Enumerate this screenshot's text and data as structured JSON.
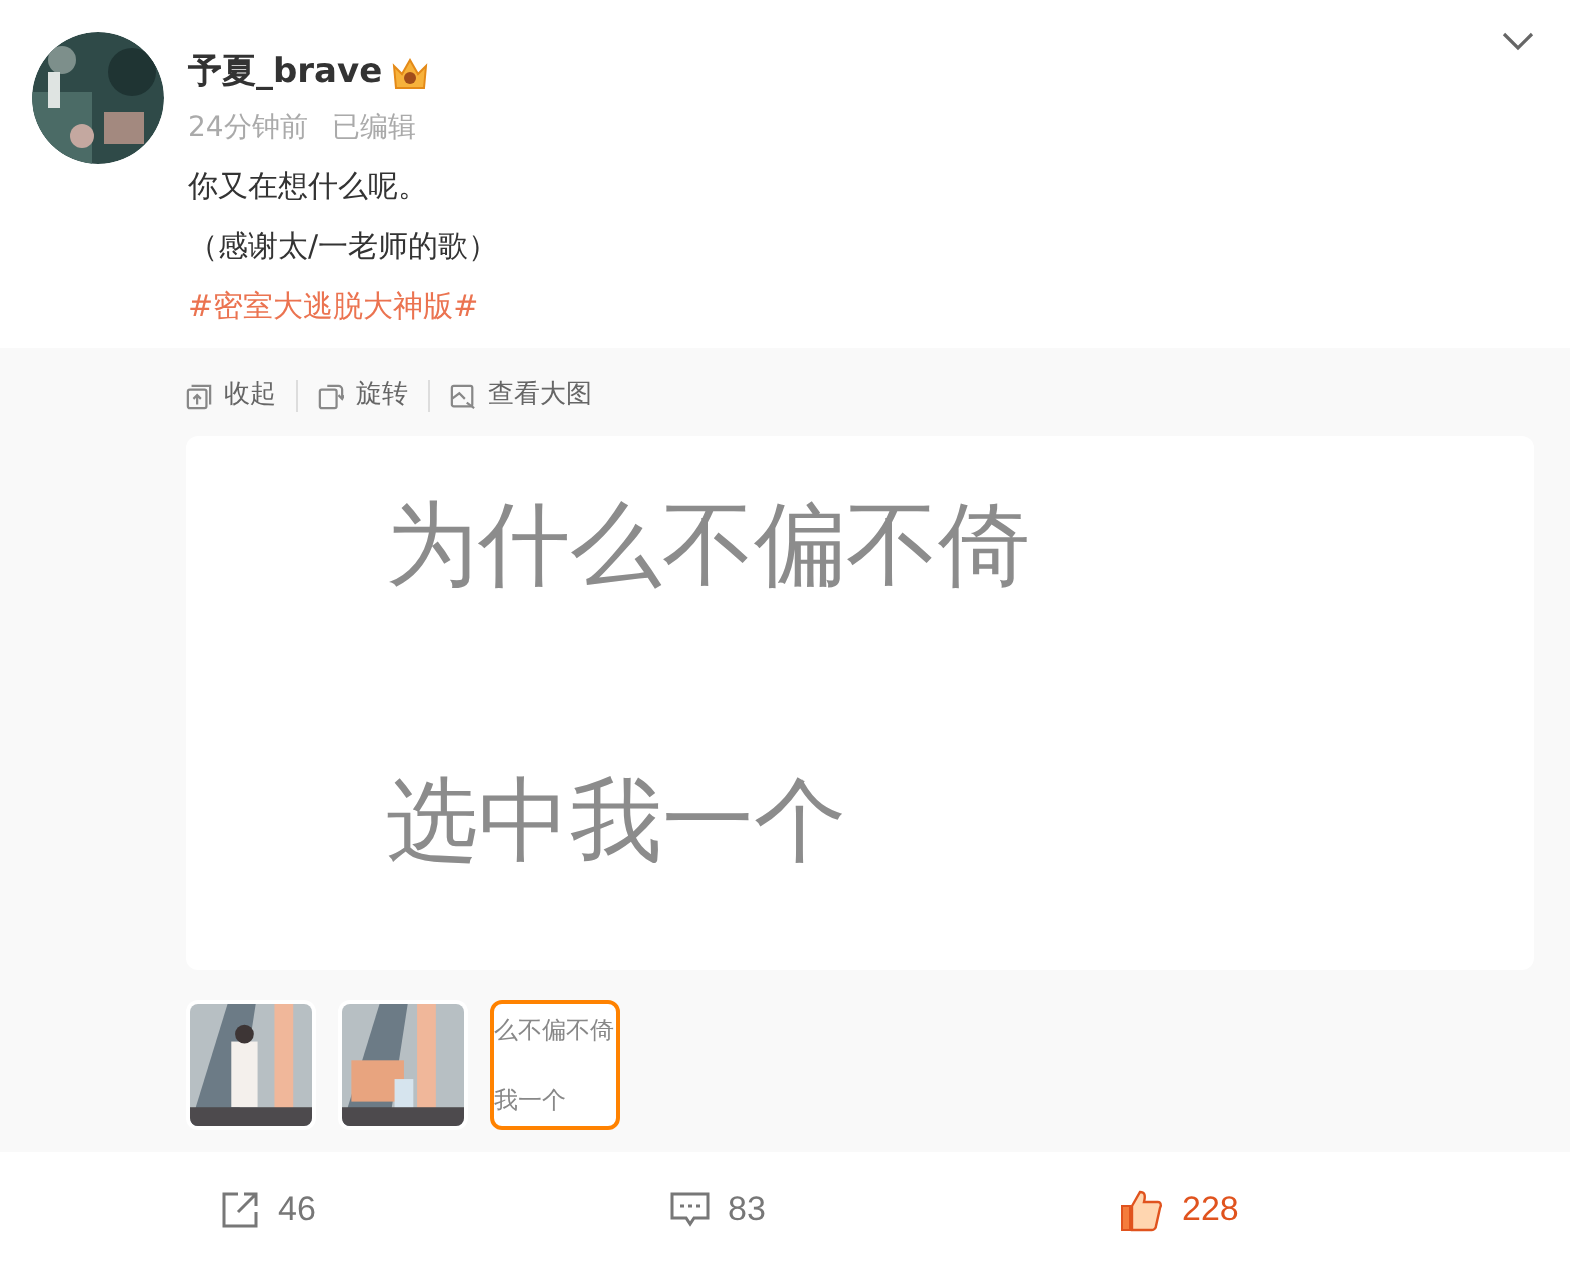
{
  "post": {
    "author": "予夏_brave",
    "time": "24分钟前",
    "edited": "已编辑",
    "lines": [
      "你又在想什么呢。",
      "（感谢太/一老师的歌）"
    ],
    "hashtag": "#密室大逃脱大神版#"
  },
  "media": {
    "toolbar": [
      {
        "kind": "collapse",
        "label": "收起"
      },
      {
        "kind": "rotate",
        "label": "旋转"
      },
      {
        "kind": "view",
        "label": "查看大图"
      }
    ],
    "image_lines": [
      "为什么不偏不倚",
      "选中我一个"
    ],
    "thumbnails": [
      {
        "kind": "picture",
        "selected": false
      },
      {
        "kind": "picture",
        "selected": false
      },
      {
        "kind": "text",
        "selected": true,
        "lines": [
          "么不偏不倚",
          "我一个"
        ]
      }
    ]
  },
  "actions": [
    {
      "kind": "share",
      "count": "46"
    },
    {
      "kind": "comment",
      "count": "83"
    },
    {
      "kind": "like",
      "count": "228",
      "liked": true
    }
  ]
}
